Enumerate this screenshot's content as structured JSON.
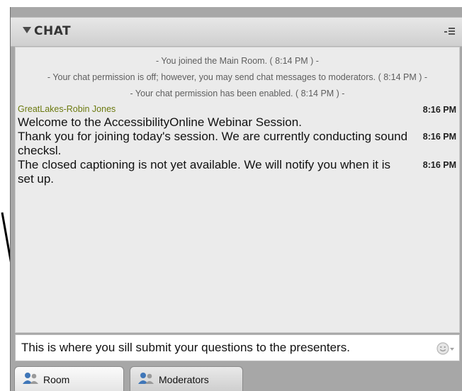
{
  "header": {
    "title": "CHAT"
  },
  "system_messages": [
    "- You joined the Main Room. ( 8:14 PM ) -",
    "- Your chat permission is off; however, you may send chat messages to moderators. ( 8:14 PM ) -",
    "- Your chat permission has been enabled. ( 8:14 PM ) -"
  ],
  "sender": {
    "name": "GreatLakes-Robin Jones",
    "time": "8:16 PM"
  },
  "messages": [
    {
      "text": "Welcome to the AccessibilityOnline Webinar Session.",
      "time": ""
    },
    {
      "text": "Thank you for joining today's session. We are currently conducting sound checksl.",
      "time": "8:16 PM"
    },
    {
      "text": "The closed captioning is not yet available. We will notify you when it is set up.",
      "time": "8:16 PM"
    }
  ],
  "input": {
    "value": "This is where you sill submit your questions to the presenters."
  },
  "tabs": [
    {
      "label": "Room",
      "icon": "users-icon",
      "active": true
    },
    {
      "label": "Moderators",
      "icon": "users-icon",
      "active": false
    }
  ],
  "colors": {
    "sender": "#6c7a10",
    "arrow": "#000000",
    "panel_bg": "#ebebeb"
  }
}
